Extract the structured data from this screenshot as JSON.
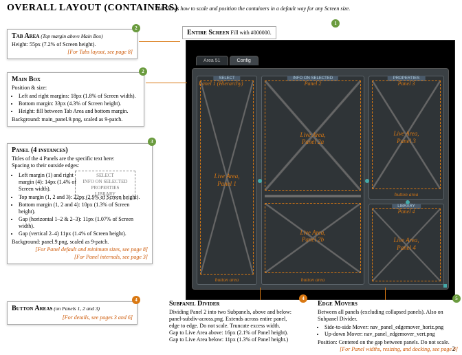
{
  "page": {
    "title": "OVERALL LAYOUT (CONTAINERS)",
    "subtitle": "This shows how to scale and position the containers in a default way for any Screen size.",
    "number": "2"
  },
  "entire_screen": {
    "title": "Entire Screen",
    "desc": "Fill with #000000."
  },
  "tab_area": {
    "title": "Tab Area",
    "extra": "(Top margin above Main Box)",
    "line1": "Height: 55px (7.2% of Screen height).",
    "ref": "[For Tabs layout, see page 8]"
  },
  "main_box": {
    "title": "Main Box",
    "pos_heading": "Position & size:",
    "b1": "Left and right margins: 18px (1.8% of Screen width).",
    "b2": "Bottom margin: 33px (4.3% of Screen height).",
    "b3": "Height: fill between Tab Area and bottom margin.",
    "bg": "Background: main_panel.9.png, scaled as 9-patch."
  },
  "panel": {
    "title": "Panel (4 instances)",
    "line0": "Titles of the 4 Panels are the specific text here:",
    "spacing": "Spacing to their outside edges:",
    "b1": "Left margin (1) and right margin (4): 14px (1.4% of Screen width).",
    "b2": "Top margin (1, 2 and 3): 22px (2.9% of Screen height).",
    "b3": "Bottom margin (1, 2 and 4): 10px (1.3% of Screen height).",
    "b4": "Gap (horizontal 1–2 & 2–3): 11px (1.07% of Screen width).",
    "b5": "Gap (vertical 2–4) 11px (1.4% of Screen height).",
    "bg": "Background: panel.9.png, scaled as 9-patch.",
    "ref1": "[For Panel default and minimum sizes, see page 8]",
    "ref2": "[For Panel internals, see page 3]",
    "labels": {
      "l1": "SELECT",
      "l2": "INFO ON SELECTED",
      "l3": "PROPERTIES",
      "l4": "LIBRARY"
    }
  },
  "button_areas": {
    "title": "Button Areas",
    "extra": "(on Panels 1, 2 and 3)",
    "ref": "[For details, see pages 3 and 6]"
  },
  "subpanel": {
    "title": "Subpanel Divider",
    "l1": "Dividing Panel 2 into two Subpanels, above and below:",
    "l2": "panel-subdiv-across.png. Extends across entire panel,",
    "l3": "edge to edge. Do not scale. Truncate excess width.",
    "l4": "Gap to Live Area above: 16px (2.1% of Panel height).",
    "l5": "Gap to Live Area below: 11px (1.3% of Panel height.)"
  },
  "edge_movers": {
    "title": "Edge Movers",
    "l1": "Between all panels (excluding collapsed panels). Also on Subpanel Divider.",
    "b1": "Side-to-side Mover: nav_panel_edgemover_horiz.png",
    "b2": "Up-down Mover: nav_panel_edgemover_vert.png",
    "l2": "Position: Centered on the gap between panels. Do not scale.",
    "ref": "[For Panel widths, resizing, and docking, see page 8]"
  },
  "screen": {
    "tabs": {
      "t1": "Area 51",
      "t2": "Config"
    },
    "panels": {
      "p1": {
        "title": "SELECT",
        "name": "Panel 1 (Hierarchy)",
        "live": "Live Area,\nPanel 1",
        "btn": "button area"
      },
      "p2": {
        "title": "INFO ON SELECTED",
        "name": "Panel 2",
        "live_a": "Live Area,\nPanel 2a",
        "live_b": "Live Area,\nPanel 2b",
        "btn": "button area"
      },
      "p3": {
        "title": "PROPERTIES",
        "name": "Panel 3",
        "live": "Live Area,\nPanel 3",
        "btn": "button area"
      },
      "p4": {
        "title": "LIBRARY",
        "name": "Panel 4",
        "live": "Live Area,\nPanel 4"
      }
    }
  },
  "badges": {
    "b1": "1",
    "b2": "2",
    "b3": "3",
    "b4": "4",
    "b5": "5"
  }
}
